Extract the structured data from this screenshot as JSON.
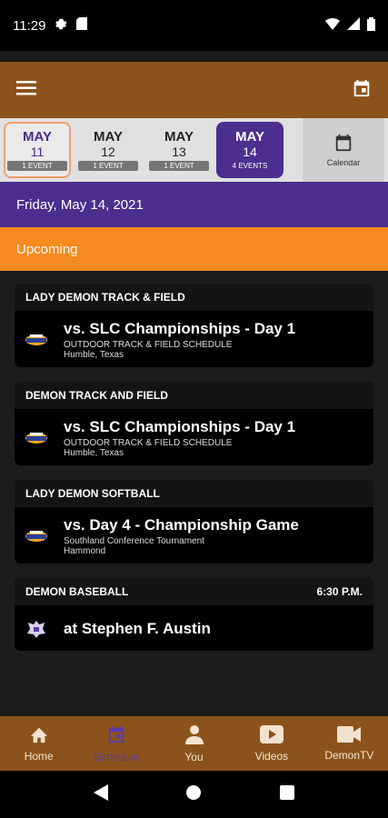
{
  "status": {
    "time": "11:29"
  },
  "app_bar": {
    "menu_icon": "menu-icon",
    "calendar_icon": "calendar-icon"
  },
  "date_strip": {
    "days": [
      {
        "month": "MAY",
        "day": "11",
        "count": "1 EVENT"
      },
      {
        "month": "MAY",
        "day": "12",
        "count": "1 EVENT"
      },
      {
        "month": "MAY",
        "day": "13",
        "count": "1 EVENT"
      },
      {
        "month": "MAY",
        "day": "14",
        "count": "4 EVENTS"
      }
    ],
    "calendar_label": "Calendar"
  },
  "date_header": "Friday, May 14, 2021",
  "section_label": "Upcoming",
  "events": [
    {
      "team": "LADY DEMON TRACK & FIELD",
      "time": "",
      "title": "vs. SLC Championships - Day 1",
      "subtitle": "OUTDOOR TRACK & FIELD SCHEDULE",
      "location": "Humble, Texas"
    },
    {
      "team": "DEMON TRACK AND FIELD",
      "time": "",
      "title": "vs. SLC Championships - Day 1",
      "subtitle": "OUTDOOR TRACK & FIELD SCHEDULE",
      "location": "Humble, Texas"
    },
    {
      "team": "LADY DEMON SOFTBALL",
      "time": "",
      "title": "vs. Day 4 - Championship Game",
      "subtitle": "Southland Conference Tournament",
      "location": "Hammond"
    },
    {
      "team": "DEMON BASEBALL",
      "time": "6:30 P.M.",
      "title": "at Stephen F. Austin",
      "subtitle": "",
      "location": ""
    }
  ],
  "bottom_nav": [
    {
      "label": "Home",
      "icon": "home-icon"
    },
    {
      "label": "Schedule",
      "icon": "schedule-icon"
    },
    {
      "label": "You",
      "icon": "person-icon"
    },
    {
      "label": "Videos",
      "icon": "video-play-icon"
    },
    {
      "label": "DemonTV",
      "icon": "camera-icon"
    }
  ],
  "colors": {
    "brand_brown": "#8b531b",
    "brand_purple": "#4b2e8e",
    "accent_orange": "#f58a1f"
  }
}
